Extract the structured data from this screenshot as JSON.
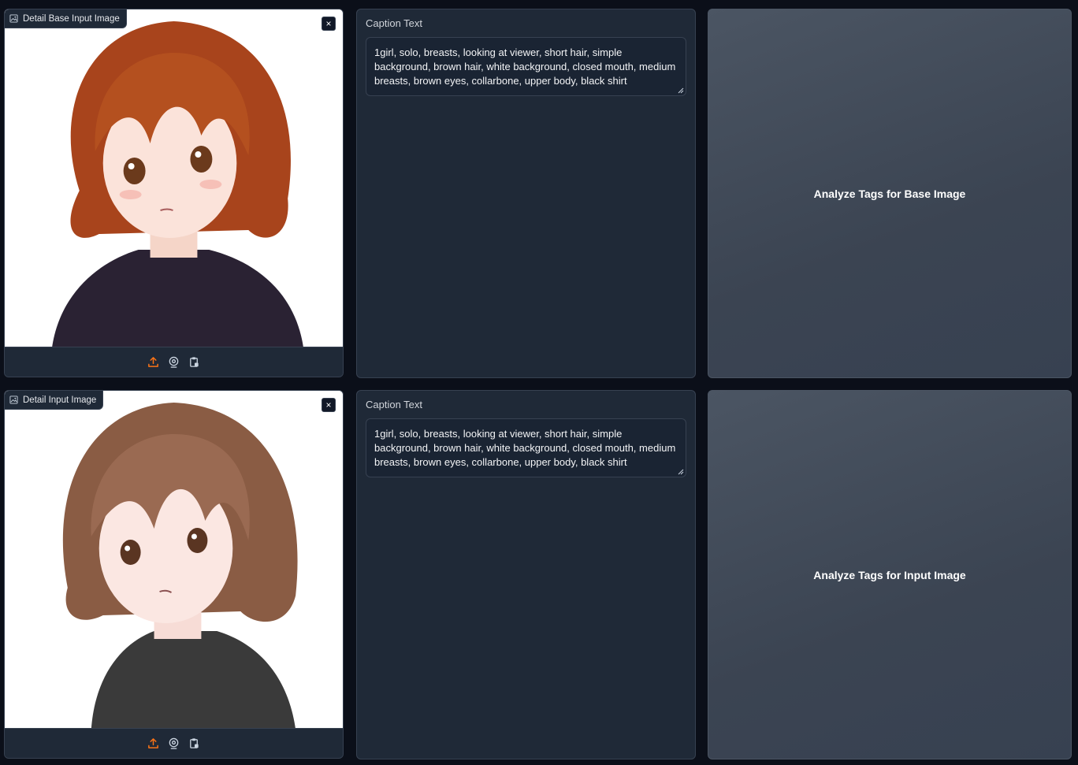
{
  "rows": [
    {
      "image_label": "Detail Base Input Image",
      "close_symbol": "×",
      "caption_title": "Caption Text",
      "caption_value": "1girl, solo, breasts, looking at viewer, short hair, simple background, brown hair, white background, closed mouth, medium breasts, brown eyes, collarbone, upper body, black shirt",
      "analyze_label": "Analyze Tags for Base Image"
    },
    {
      "image_label": "Detail Input Image",
      "close_symbol": "×",
      "caption_title": "Caption Text",
      "caption_value": "1girl, solo, breasts, looking at viewer, short hair, simple background, brown hair, white background, closed mouth, medium breasts, brown eyes, collarbone, upper body, black shirt",
      "analyze_label": "Analyze Tags for Input Image"
    }
  ],
  "icons": {
    "label": "image-icon",
    "upload": "upload-icon",
    "webcam": "webcam-icon",
    "clipboard": "clipboard-icon",
    "close": "close-icon"
  },
  "colors": {
    "background": "#0b0f19",
    "panel": "#1f2937",
    "accent": "#f97316",
    "button": "#4b5563"
  }
}
